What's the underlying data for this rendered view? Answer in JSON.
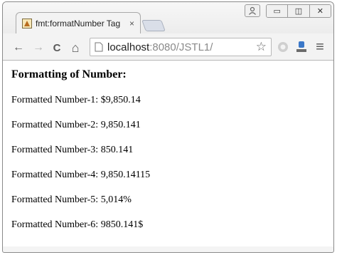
{
  "browser": {
    "tab": {
      "title": "fmt:formatNumber Tag",
      "close": "×"
    },
    "window_controls": {
      "minimize": "▭",
      "restore": "◫",
      "close": "✕"
    },
    "toolbar": {
      "back": "←",
      "forward": "→",
      "reload": "C",
      "home": "⌂",
      "url_host": "localhost",
      "url_rest": ":8080/JSTL1/",
      "bookmark": "☆",
      "menu": "≡"
    }
  },
  "page": {
    "heading": "Formatting of Number:",
    "lines": [
      "Formatted Number-1: $9,850.14",
      "Formatted Number-2: 9,850.141",
      "Formatted Number-3: 850.141",
      "Formatted Number-4: 9,850.14115",
      "Formatted Number-5: 5,014%",
      "Formatted Number-6: 9850.141$"
    ]
  }
}
